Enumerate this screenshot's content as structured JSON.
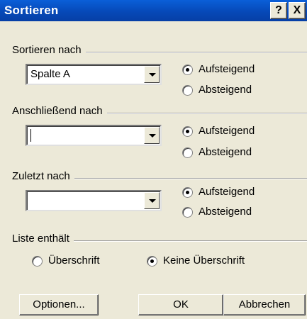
{
  "window": {
    "title": "Sortieren",
    "help_label": "?",
    "close_label": "X"
  },
  "sort_by": {
    "label": "Sortieren nach",
    "field_value": "Spalte A",
    "ascending_label": "Aufsteigend",
    "descending_label": "Absteigend",
    "selected": "ascending"
  },
  "then_by": {
    "label": "Anschließend nach",
    "field_value": "",
    "ascending_label": "Aufsteigend",
    "descending_label": "Absteigend",
    "selected": "ascending"
  },
  "finally_by": {
    "label": "Zuletzt nach",
    "field_value": "",
    "ascending_label": "Aufsteigend",
    "descending_label": "Absteigend",
    "selected": "ascending"
  },
  "header_row": {
    "label": "Liste enthält",
    "with_header_label": "Überschrift",
    "no_header_label": "Keine Überschrift",
    "selected": "no_header"
  },
  "buttons": {
    "options_label": "Optionen...",
    "ok_label": "OK",
    "cancel_label": "Abbrechen"
  },
  "colors": {
    "dialog_background": "#ece9d8",
    "titlebar_blue": "#0649b8",
    "title_text": "#ffffff"
  }
}
